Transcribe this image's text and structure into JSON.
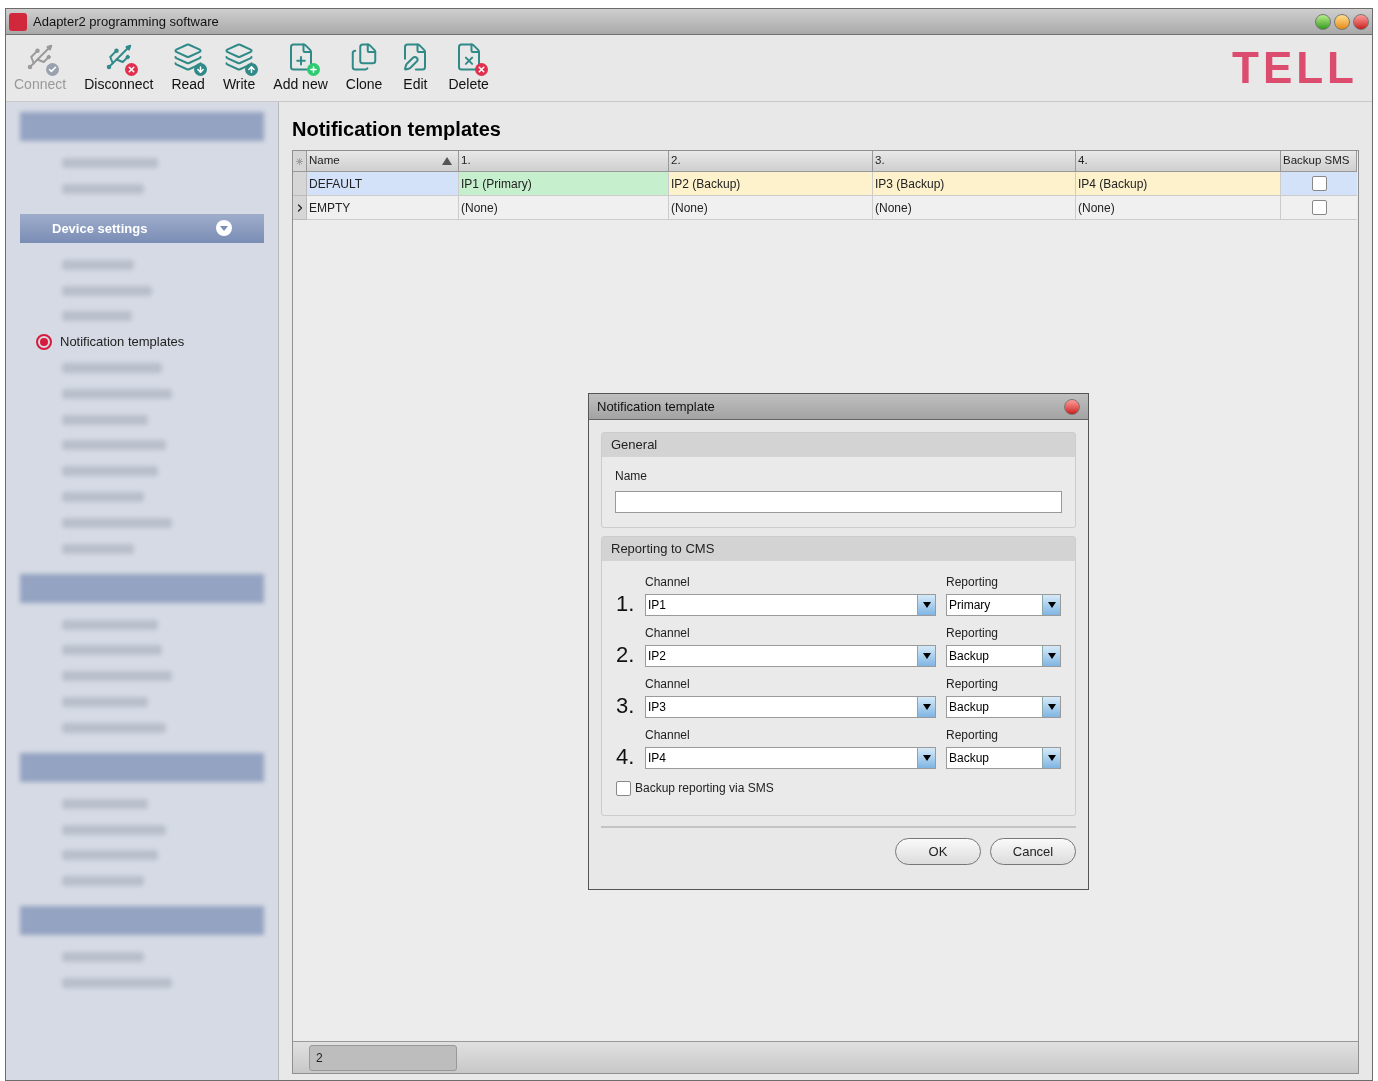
{
  "window": {
    "title": "Adapter2 programming software"
  },
  "toolbar": [
    {
      "label": "Connect",
      "kind": "connect",
      "disabled": true
    },
    {
      "label": "Disconnect",
      "kind": "disconnect",
      "disabled": false
    },
    {
      "label": "Read",
      "kind": "read",
      "disabled": false
    },
    {
      "label": "Write",
      "kind": "write",
      "disabled": false
    },
    {
      "label": "Add new",
      "kind": "add",
      "disabled": false
    },
    {
      "label": "Clone",
      "kind": "clone",
      "disabled": false
    },
    {
      "label": "Edit",
      "kind": "edit",
      "disabled": false
    },
    {
      "label": "Delete",
      "kind": "delete",
      "disabled": false
    }
  ],
  "logo": "TELL",
  "sidebar": [
    {
      "kind": "blurred",
      "items": [
        {
          "kind": "blurred"
        },
        {
          "kind": "blurred"
        }
      ]
    },
    {
      "kind": "header",
      "title": "Device settings",
      "items": [
        {
          "kind": "blurred"
        },
        {
          "kind": "blurred"
        },
        {
          "kind": "blurred"
        },
        {
          "kind": "item",
          "label": "Notification templates",
          "selected": true
        },
        {
          "kind": "blurred"
        },
        {
          "kind": "blurred"
        },
        {
          "kind": "blurred"
        },
        {
          "kind": "blurred"
        },
        {
          "kind": "blurred"
        },
        {
          "kind": "blurred"
        },
        {
          "kind": "blurred"
        },
        {
          "kind": "blurred"
        }
      ]
    },
    {
      "kind": "blurred",
      "items": [
        {
          "kind": "blurred"
        },
        {
          "kind": "blurred"
        },
        {
          "kind": "blurred"
        },
        {
          "kind": "blurred"
        },
        {
          "kind": "blurred"
        }
      ]
    },
    {
      "kind": "blurred",
      "items": [
        {
          "kind": "blurred"
        },
        {
          "kind": "blurred"
        },
        {
          "kind": "blurred"
        },
        {
          "kind": "blurred"
        }
      ]
    },
    {
      "kind": "blurred",
      "items": [
        {
          "kind": "blurred"
        },
        {
          "kind": "blurred"
        }
      ]
    }
  ],
  "page": {
    "title": "Notification templates"
  },
  "table": {
    "columns": [
      {
        "label": "Name",
        "sorted_ascending": true
      },
      {
        "label": "1."
      },
      {
        "label": "2."
      },
      {
        "label": "3."
      },
      {
        "label": "4."
      },
      {
        "label": "Backup SMS"
      }
    ],
    "rows": [
      {
        "selected": true,
        "current": false,
        "backup_sms": false,
        "cells": [
          {
            "text": "DEFAULT",
            "kind": "name"
          },
          {
            "text": "IP1 (Primary)",
            "kind": "primary"
          },
          {
            "text": "IP2 (Backup)",
            "kind": "backup"
          },
          {
            "text": "IP3 (Backup)",
            "kind": "backup"
          },
          {
            "text": "IP4 (Backup)",
            "kind": "backup"
          }
        ]
      },
      {
        "selected": false,
        "current": true,
        "backup_sms": false,
        "cells": [
          {
            "text": "EMPTY",
            "kind": "name"
          },
          {
            "text": "(None)",
            "kind": "none"
          },
          {
            "text": "(None)",
            "kind": "none"
          },
          {
            "text": "(None)",
            "kind": "none"
          },
          {
            "text": "(None)",
            "kind": "none"
          }
        ]
      }
    ]
  },
  "footer": {
    "record_count": "2"
  },
  "dialog": {
    "title": "Notification template",
    "general": {
      "title": "General",
      "name_label": "Name"
    },
    "reporting": {
      "title": "Reporting to CMS",
      "channels": [
        {
          "number": "1.",
          "channel_label": "Channel",
          "channel": "IP1",
          "reporting_label": "Reporting",
          "reporting": "Primary"
        },
        {
          "number": "2.",
          "channel_label": "Channel",
          "channel": "IP2",
          "reporting_label": "Reporting",
          "reporting": "Backup"
        },
        {
          "number": "3.",
          "channel_label": "Channel",
          "channel": "IP3",
          "reporting_label": "Reporting",
          "reporting": "Backup"
        },
        {
          "number": "4.",
          "channel_label": "Channel",
          "channel": "IP4",
          "reporting_label": "Reporting",
          "reporting": "Backup"
        }
      ],
      "backup_sms": {
        "label": "Backup reporting via SMS",
        "checked": false
      }
    },
    "buttons": [
      "OK",
      "Cancel"
    ]
  }
}
